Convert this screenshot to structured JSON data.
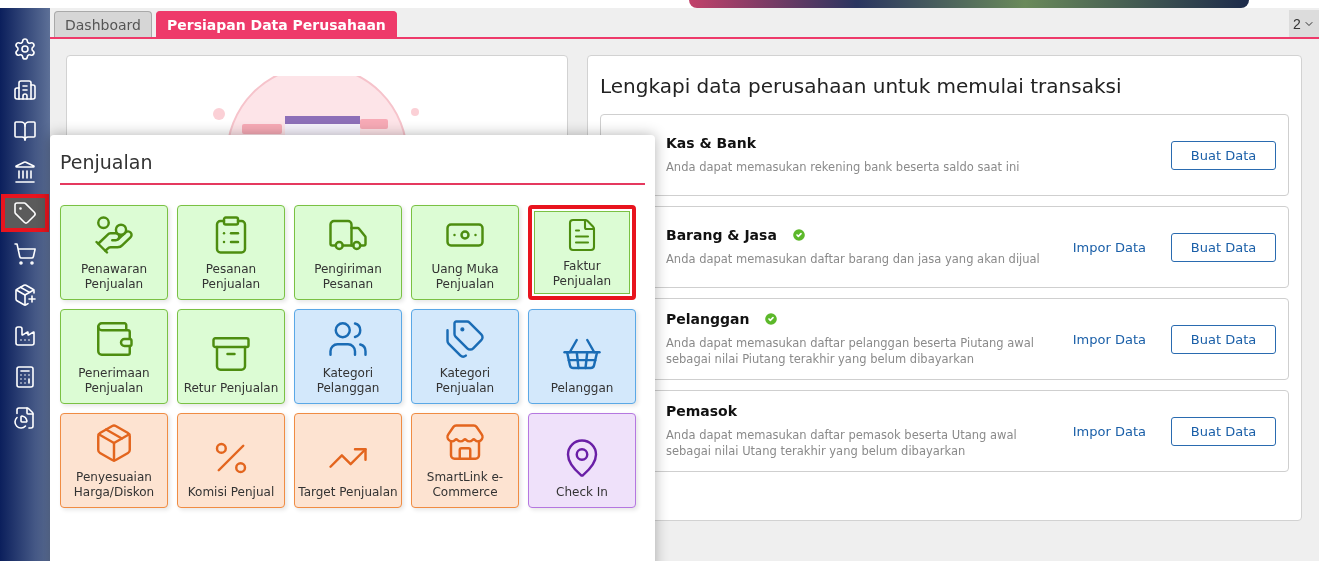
{
  "tabs": [
    {
      "label": "Dashboard",
      "selected": false
    },
    {
      "label": "Persiapan Data Perusahaan",
      "selected": true
    }
  ],
  "tab_menu": {
    "label": "2"
  },
  "sidebar": {
    "items": [
      {
        "selected": false
      },
      {
        "selected": false
      },
      {
        "selected": false
      },
      {
        "selected": false
      },
      {
        "selected": true
      },
      {
        "selected": false
      },
      {
        "selected": false
      },
      {
        "selected": false
      },
      {
        "selected": false
      },
      {
        "selected": false
      }
    ]
  },
  "setup_panel": {
    "title": "Lengkapi data perusahaan untuk memulai transaksi",
    "rows": [
      {
        "name": "Kas & Bank",
        "checked": false,
        "description": "Anda dapat memasukan rekening bank beserta saldo saat ini",
        "create_label": "Buat Data"
      },
      {
        "name": "Barang & Jasa",
        "checked": true,
        "description": "Anda dapat memasukan daftar barang dan jasa yang akan dijual",
        "import_label": "Impor Data",
        "create_label": "Buat Data"
      },
      {
        "name": "Pelanggan",
        "checked": true,
        "description": "Anda dapat memasukan daftar pelanggan beserta Piutang awal sebagai nilai Piutang terakhir yang belum dibayarkan",
        "import_label": "Impor Data",
        "create_label": "Buat Data"
      },
      {
        "name": "Pemasok",
        "checked": false,
        "description": "Anda dapat memasukan daftar pemasok beserta Utang awal sebagai nilai Utang terakhir yang belum dibayarkan",
        "import_label": "Impor Data",
        "create_label": "Buat Data"
      }
    ]
  },
  "menu_popup": {
    "title": "Penjualan",
    "tiles": [
      {
        "label": "Penawaran Penjualan",
        "kind": "green",
        "selected": false
      },
      {
        "label": "Pesanan Penjualan",
        "kind": "green",
        "selected": false
      },
      {
        "label": "Pengiriman Pesanan",
        "kind": "green",
        "selected": false
      },
      {
        "label": "Uang Muka Penjualan",
        "kind": "green",
        "selected": false
      },
      {
        "label": "Faktur Penjualan",
        "kind": "green",
        "selected": true
      },
      {
        "label": "Penerimaan Penjualan",
        "kind": "green",
        "selected": false
      },
      {
        "label": "Retur Penjualan",
        "kind": "green",
        "selected": false
      },
      {
        "label": "Kategori Pelanggan",
        "kind": "blue",
        "selected": false
      },
      {
        "label": "Kategori Penjualan",
        "kind": "blue",
        "selected": false
      },
      {
        "label": "Pelanggan",
        "kind": "blue",
        "selected": false
      },
      {
        "label": "Penyesuaian Harga/Diskon",
        "kind": "orange",
        "selected": false
      },
      {
        "label": "Komisi Penjual",
        "kind": "orange",
        "selected": false
      },
      {
        "label": "Target Penjualan",
        "kind": "orange",
        "selected": false
      },
      {
        "label": "SmartLink e-Commerce",
        "kind": "orange",
        "selected": false
      },
      {
        "label": "Check In",
        "kind": "purple",
        "selected": false
      }
    ]
  }
}
